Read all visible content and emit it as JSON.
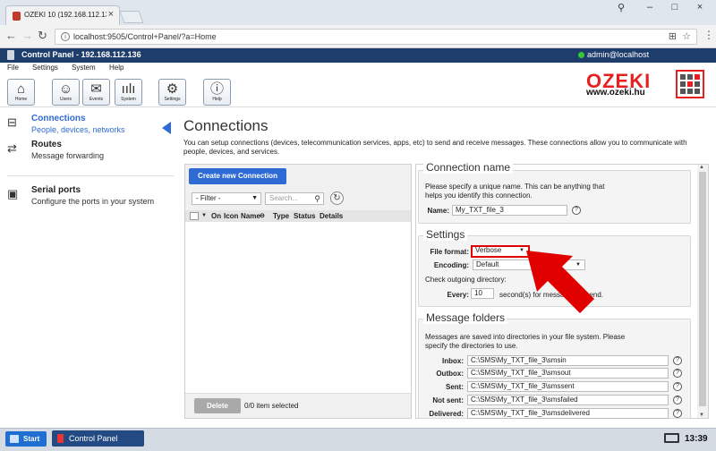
{
  "browser": {
    "tab_title": "OZEKI 10 (192.168.112.136",
    "url": "localhost:9505/Control+Panel/?a=Home"
  },
  "app": {
    "header_title": "Control Panel - 192.168.112.136",
    "user": "admin@localhost"
  },
  "menu": [
    "File",
    "Settings",
    "System",
    "Help"
  ],
  "toolbar": {
    "buttons": [
      {
        "label": "Home",
        "icon": "home-icon"
      },
      {
        "label": "Users",
        "icon": "user-icon"
      },
      {
        "label": "Events",
        "icon": "events-icon"
      },
      {
        "label": "System",
        "icon": "chart-icon"
      },
      {
        "label": "Settings",
        "icon": "gear-icon"
      },
      {
        "label": "Help",
        "icon": "info-icon"
      }
    ]
  },
  "logo": {
    "brand": "OZEKI",
    "site": "www.ozeki.hu"
  },
  "sidebar": {
    "items": [
      {
        "title": "Connections",
        "desc": "People, devices, networks",
        "icon": "connections-icon"
      },
      {
        "title": "Routes",
        "desc": "Message forwarding",
        "icon": "routes-icon"
      },
      {
        "title": "Serial ports",
        "desc": "Configure the ports in your system",
        "icon": "serial-icon"
      }
    ]
  },
  "page": {
    "title": "Connections",
    "description": "You can setup connections (devices, telecommunication services, apps, etc) to send and receive messages. These connections allow you to communicate with people, devices, and services."
  },
  "connections_list": {
    "create_button": "Create new Connection",
    "filter_value": "- Filter -",
    "search_placeholder": "Search...",
    "columns": [
      "On",
      "Icon",
      "Name",
      "Type",
      "Status",
      "Details"
    ],
    "delete_button": "Delete",
    "selection_status": "0/0 item selected"
  },
  "form": {
    "connection_name": {
      "legend": "Connection name",
      "hint": "Please specify a unique name. This can be anything that helps you identify this connection.",
      "name_label": "Name:",
      "name_value": "My_TXT_file_3"
    },
    "settings": {
      "legend": "Settings",
      "file_format_label": "File format:",
      "file_format_value": "Verbose",
      "encoding_label": "Encoding:",
      "encoding_value": "Default",
      "check_label": "Check outgoing directory:",
      "every_label": "Every:",
      "every_value": "10",
      "every_suffix": "second(s) for messages to send."
    },
    "folders": {
      "legend": "Message folders",
      "hint": "Messages are saved into directories in your file system. Please specify the directories to use.",
      "rows": [
        {
          "label": "Inbox:",
          "value": "C:\\SMS\\My_TXT_file_3\\smsin"
        },
        {
          "label": "Outbox:",
          "value": "C:\\SMS\\My_TXT_file_3\\smsout"
        },
        {
          "label": "Sent:",
          "value": "C:\\SMS\\My_TXT_file_3\\smssent"
        },
        {
          "label": "Not sent:",
          "value": "C:\\SMS\\My_TXT_file_3\\smsfailed"
        },
        {
          "label": "Delivered:",
          "value": "C:\\SMS\\My_TXT_file_3\\smsdelivered"
        }
      ]
    }
  },
  "taskbar": {
    "start_label": "Start",
    "app_label": "Control Panel",
    "clock": "13:39"
  },
  "colors": {
    "header_bg": "#1e3d6b",
    "accent_blue": "#2f6bd4",
    "highlight_red": "#e00000",
    "brand_red": "#e62020"
  }
}
